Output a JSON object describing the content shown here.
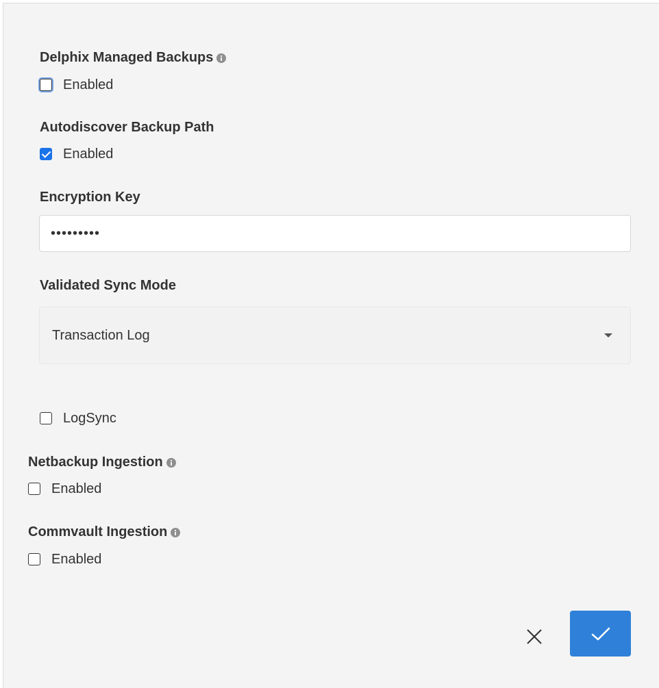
{
  "form": {
    "managed_backups": {
      "label": "Delphix Managed Backups",
      "checkbox_label": "Enabled",
      "checked": false
    },
    "autodiscover": {
      "label": "Autodiscover Backup Path",
      "checkbox_label": "Enabled",
      "checked": true
    },
    "encryption_key": {
      "label": "Encryption Key",
      "value": "•••••••••"
    },
    "sync_mode": {
      "label": "Validated Sync Mode",
      "selected": "Transaction Log"
    },
    "logsync": {
      "checkbox_label": "LogSync",
      "checked": false
    },
    "netbackup": {
      "label": "Netbackup Ingestion",
      "checkbox_label": "Enabled",
      "checked": false
    },
    "commvault": {
      "label": "Commvault Ingestion",
      "checkbox_label": "Enabled",
      "checked": false
    }
  },
  "actions": {
    "cancel_icon": "close-icon",
    "confirm_icon": "checkmark-icon"
  },
  "colors": {
    "panel_background": "#f4f4f4",
    "accent": "#2f80d8",
    "checkbox_checked": "#1a73e8",
    "text": "#333333"
  }
}
